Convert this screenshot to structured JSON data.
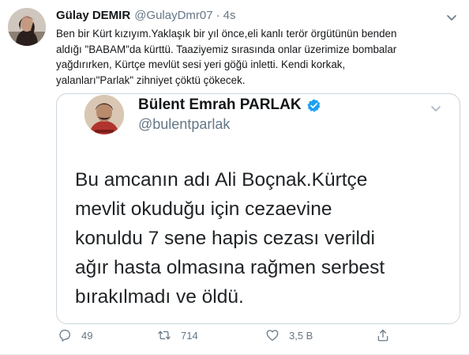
{
  "tweet": {
    "display_name": "Gülay DEMIR",
    "handle": "@GulayDmr07",
    "separator": "·",
    "time": "4s",
    "text": "Ben bir Kürt kızıyım.Yaklaşık bir yıl önce,eli kanlı terör örgütünün benden\naldığı \"BABAM\"da kürttü. Taaziyemiz sırasında onlar üzerimize bombalar\nyağdırırken, Kürtçe mevlüt sesi yeri göğü inletti. Kendi korkak,\nyalanları\"Parlak\" zihniyet çöktü çökecek.",
    "avatar_icon": "profile-photo",
    "caret_icon": "chevron-down-icon"
  },
  "quoted": {
    "display_name": "Bülent Emrah PARLAK",
    "handle": "@bulentparlak",
    "verified_icon": "verified-badge-icon",
    "verified_color": "#1da1f2",
    "text": "Bu amcanın adı Ali Boçnak.Kürtçe\nmevlit okuduğu için cezaevine\nkonuldu 7 sene hapis cezası verildi\nağır hasta olmasına rağmen serbest\nbırakılmadı ve öldü."
  },
  "actions": {
    "reply_count": "49",
    "retweet_count": "714",
    "like_count": "3,5 B",
    "reply_icon": "reply-icon",
    "retweet_icon": "retweet-icon",
    "like_icon": "heart-icon",
    "share_icon": "share-icon"
  },
  "colors": {
    "text_primary": "#14171a",
    "text_secondary": "#657786",
    "border": "#ccd6dd",
    "accent": "#1da1f2"
  }
}
